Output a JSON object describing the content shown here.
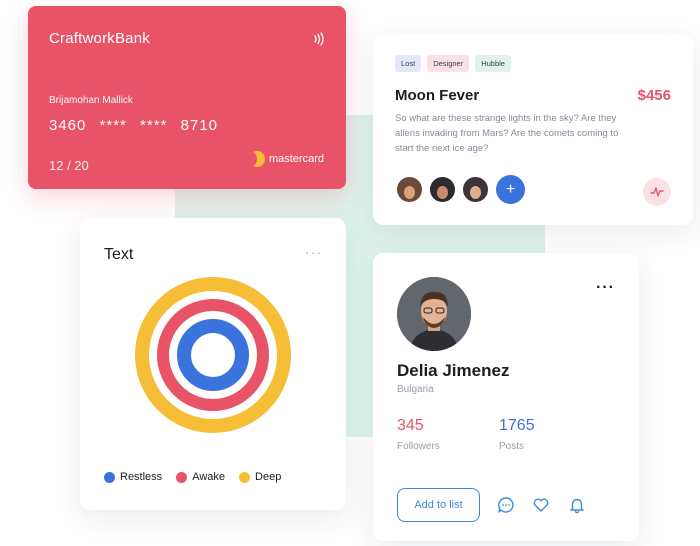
{
  "colors": {
    "accent_red": "#e85368",
    "accent_blue": "#3b73dc",
    "accent_yellow": "#f6bd36",
    "backdrop": "#dff2ec"
  },
  "credit_card": {
    "bank": "CraftworkBank",
    "holder": "Brijamohan Mallick",
    "number": "3460 **** **** 8710",
    "expiry": "12 / 20",
    "brand": "mastercard",
    "icons": [
      "contactless-icon",
      "mastercard-logo"
    ]
  },
  "moon_card": {
    "tags": [
      {
        "label": "Lost",
        "color": "#e3e9fb"
      },
      {
        "label": "Designer",
        "color": "#fbe1e5"
      },
      {
        "label": "Hubble",
        "color": "#dff2ec"
      }
    ],
    "title": "Moon Fever",
    "price": "$456",
    "description": "So what are these strange lights in the sky? Are they aliens invading from Mars? Are the comets coming to start the next ice age?",
    "add_label": "+",
    "icons": [
      "avatar",
      "avatar",
      "avatar",
      "plus-icon",
      "activity-icon"
    ]
  },
  "rings_card": {
    "title": "Text",
    "more": "···",
    "legend": [
      {
        "label": "Restless",
        "color": "#3b73dc"
      },
      {
        "label": "Awake",
        "color": "#e85368"
      },
      {
        "label": "Deep",
        "color": "#f6bd36"
      }
    ]
  },
  "profile": {
    "more": "···",
    "name": "Delia Jimenez",
    "location": "Bulgaria",
    "followers_count": "345",
    "followers_label": "Followers",
    "posts_count": "1765",
    "posts_label": "Posts",
    "add_button": "Add to list",
    "icons": [
      "chat-icon",
      "heart-icon",
      "bell-icon"
    ]
  }
}
